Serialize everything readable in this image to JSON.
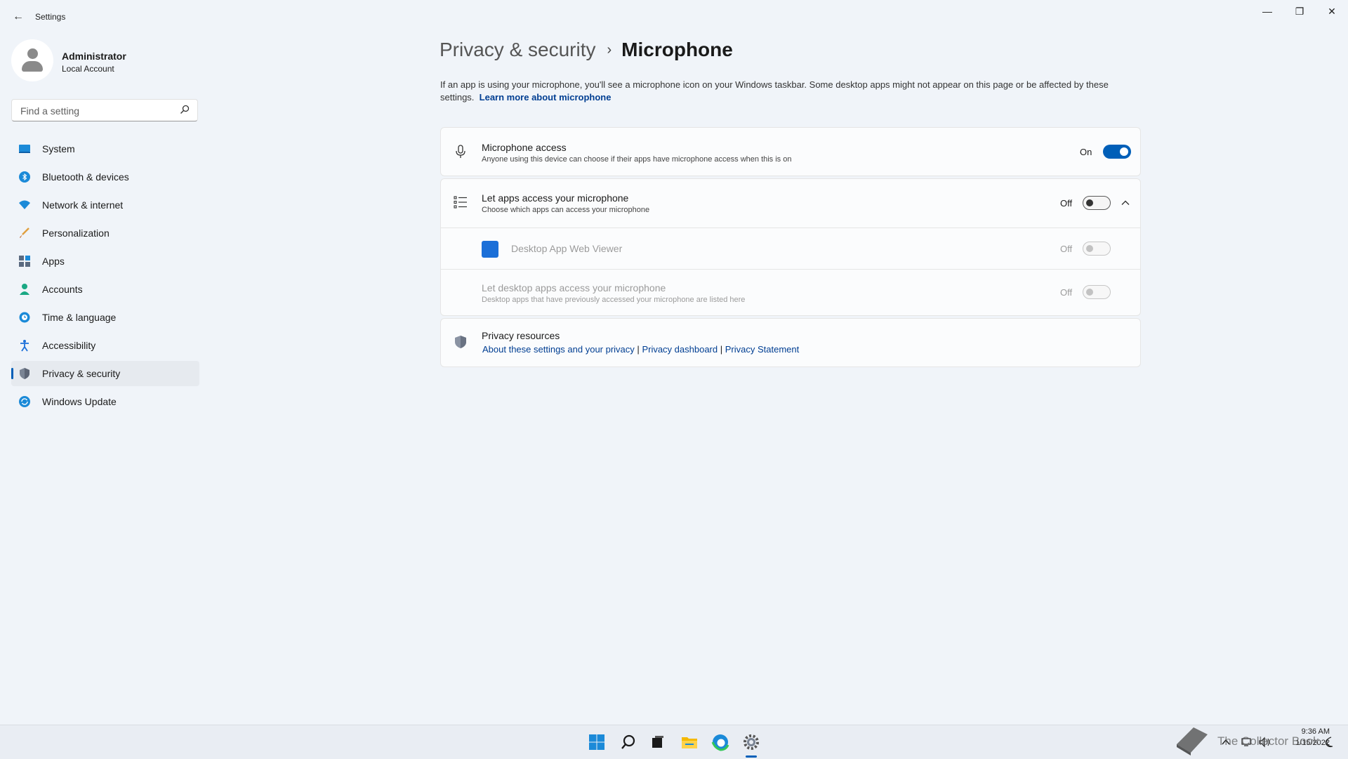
{
  "window": {
    "title": "Settings",
    "back_glyph": "←",
    "minimize_glyph": "—",
    "restore_glyph": "❐",
    "close_glyph": "✕"
  },
  "profile": {
    "name": "Administrator",
    "account_type": "Local Account"
  },
  "search": {
    "placeholder": "Find a setting"
  },
  "sidebar": {
    "items": [
      {
        "label": "System",
        "icon": "monitor-icon",
        "active": false
      },
      {
        "label": "Bluetooth & devices",
        "icon": "bluetooth-icon",
        "active": false
      },
      {
        "label": "Network & internet",
        "icon": "wifi-icon",
        "active": false
      },
      {
        "label": "Personalization",
        "icon": "brush-icon",
        "active": false
      },
      {
        "label": "Apps",
        "icon": "apps-icon",
        "active": false
      },
      {
        "label": "Accounts",
        "icon": "person-icon",
        "active": false
      },
      {
        "label": "Time & language",
        "icon": "globe-clock-icon",
        "active": false
      },
      {
        "label": "Accessibility",
        "icon": "accessibility-icon",
        "active": false
      },
      {
        "label": "Privacy & security",
        "icon": "shield-icon",
        "active": true
      },
      {
        "label": "Windows Update",
        "icon": "update-icon",
        "active": false
      }
    ]
  },
  "breadcrumb": {
    "parent": "Privacy & security",
    "separator": "›",
    "current": "Microphone"
  },
  "description": {
    "text": "If an app is using your microphone, you'll see a microphone icon on your Windows taskbar. Some desktop apps might not appear on this page or be affected by these settings.",
    "link": "Learn more about microphone"
  },
  "microphone_access": {
    "title": "Microphone access",
    "subtitle": "Anyone using this device can choose if their apps have microphone access when this is on",
    "state": "On",
    "enabled": true
  },
  "let_apps_access": {
    "title": "Let apps access your microphone",
    "subtitle": "Choose which apps can access your microphone",
    "state": "Off",
    "enabled": false,
    "expanded": true
  },
  "app_rows": [
    {
      "name": "Desktop App Web Viewer",
      "state": "Off"
    }
  ],
  "desktop_apps": {
    "title": "Let desktop apps access your microphone",
    "subtitle": "Desktop apps that have previously accessed your microphone are listed here",
    "state": "Off"
  },
  "privacy_resources": {
    "title": "Privacy resources",
    "links": [
      "About these settings and your privacy",
      "Privacy dashboard",
      "Privacy Statement"
    ],
    "divider": "|"
  },
  "taskbar": {
    "icons": [
      "windows-start-icon",
      "search-icon",
      "task-view-icon",
      "file-explorer-icon",
      "edge-icon",
      "settings-gear-icon"
    ],
    "time": "9:36 AM",
    "date": "1/15/2022",
    "watermark": "The Collector Book"
  },
  "colors": {
    "accent": "#005fb8",
    "link": "#003e92",
    "background": "#f0f4f9"
  }
}
